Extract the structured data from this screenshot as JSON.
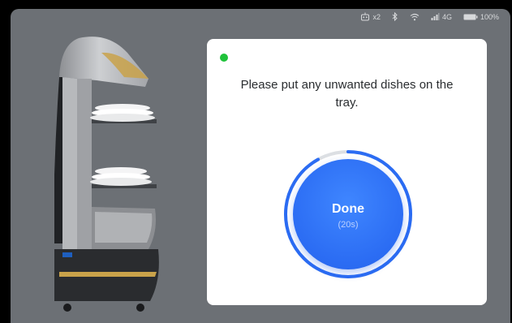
{
  "status_bar": {
    "robot_count": "x2",
    "network": "4G",
    "battery": "100%",
    "icons": [
      "robot-icon",
      "bluetooth-icon",
      "wifi-icon",
      "signal-icon",
      "battery-icon"
    ]
  },
  "dialog": {
    "message": "Please put any unwanted dishes on the tray.",
    "status_color": "#1fc23a",
    "done_label": "Done",
    "countdown": "(20s)",
    "progress_fraction": 0.92
  },
  "colors": {
    "accent": "#2b6cf3",
    "background": "#6c7075"
  }
}
